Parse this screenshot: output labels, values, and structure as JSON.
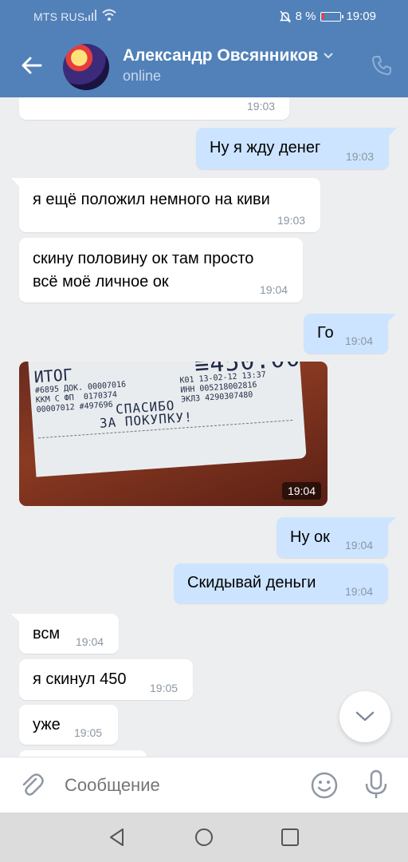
{
  "status_bar": {
    "carrier": "MTS RUS",
    "battery_percent": "8 %",
    "time": "19:09"
  },
  "header": {
    "contact_name": "Александр Овсянников",
    "presence": "online"
  },
  "messages": [
    {
      "direction": "in",
      "text": "",
      "time": "19:03"
    },
    {
      "direction": "out",
      "text": "Ну я жду денег",
      "time": "19:03"
    },
    {
      "direction": "in",
      "text": "я ещё положил немного на киви",
      "time": "19:03"
    },
    {
      "direction": "in",
      "text": "скину половину ок там просто\nвсё моё личное ок",
      "time": "19:04"
    },
    {
      "direction": "out",
      "text": "Го",
      "time": "19:04"
    },
    {
      "direction": "in",
      "type": "photo",
      "time": "19:04",
      "photo_text": {
        "itog": "ИТОГ",
        "sum": "≡450.00",
        "thanks": "СПАСИБО\nЗА ПОКУПКУ!",
        "left_lines": "#6895 ДОК. 00007016\nККМ С ФП  0170374\n00007012 #497696",
        "right_lines": "К01 13-02-12 13:37\nИНН 005218002816\nЭКЛЗ 4290307480"
      }
    },
    {
      "direction": "out",
      "text": "Ну ок",
      "time": "19:04"
    },
    {
      "direction": "out",
      "text": "Скидывай деньги",
      "time": "19:04"
    },
    {
      "direction": "in",
      "text": "всм",
      "time": "19:04"
    },
    {
      "direction": "in",
      "text": "я скинул 450",
      "time": "19:05"
    },
    {
      "direction": "in",
      "text": "уже",
      "time": "19:05"
    }
  ],
  "composer": {
    "placeholder": "Сообщение"
  },
  "colors": {
    "header_bg": "#5181b8",
    "outgoing_bubble": "#cce4ff",
    "incoming_bubble": "#ffffff",
    "chat_bg": "#edeef0"
  },
  "icons": [
    "back-arrow-icon",
    "chevron-down-icon",
    "phone-icon",
    "paperclip-icon",
    "smile-icon",
    "mic-icon",
    "scroll-down-icon",
    "nav-back-icon",
    "nav-home-icon",
    "nav-recents-icon"
  ]
}
